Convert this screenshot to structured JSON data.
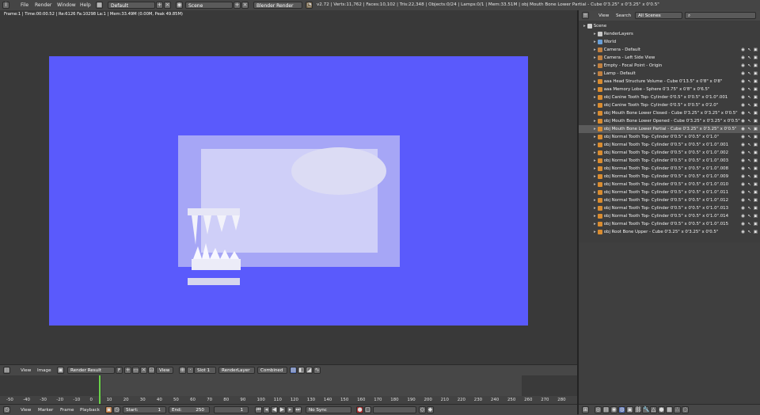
{
  "top": {
    "menus": [
      "File",
      "Render",
      "Window",
      "Help"
    ],
    "layout": "Default",
    "scene": "Scene",
    "engine": "Blender Render",
    "stats": "v2.72 | Verts:11,762 | Faces:10,102 | Tris:22,348 | Objects:0/24 | Lamps:0/1 | Mem:33.51M | obj Mouth Bone Lower Partial - Cube 0'3.25\" x 0'3.25\" x 0'0.5\""
  },
  "viewport": {
    "render_info": "Frame:1 | Time:00:00.52 | Re:6126 Fa:10298 La:1 | Mem:33.49M (0.00M, Peak 49.85M)"
  },
  "image_editor": {
    "view": "View",
    "image": "Image",
    "image_name": "Render Result",
    "f_label": "F",
    "view_dropdown": "View",
    "slot": "Slot 1",
    "layer": "RenderLayer",
    "pass": "Combined"
  },
  "timeline": {
    "ticks": [
      "-50",
      "-40",
      "-30",
      "-20",
      "-10",
      "0",
      "10",
      "20",
      "30",
      "40",
      "50",
      "60",
      "70",
      "80",
      "90",
      "100",
      "110",
      "120",
      "130",
      "140",
      "150",
      "160",
      "170",
      "180",
      "190",
      "200",
      "210",
      "220",
      "230",
      "240",
      "250",
      "260",
      "270",
      "280"
    ],
    "current_frame": 1,
    "menu": [
      "View",
      "Marker",
      "Frame",
      "Playback"
    ],
    "start": "Start:",
    "start_val": "1",
    "end": "End:",
    "end_val": "250",
    "frame": "1",
    "sync": "No Sync"
  },
  "outliner": {
    "view": "View",
    "search": "Search",
    "scenes": "All Scenes",
    "rows": [
      {
        "label": "Scene",
        "indent": 0,
        "color": "#d0d0d0"
      },
      {
        "label": "RenderLayers",
        "indent": 1,
        "color": "#c8c8c8"
      },
      {
        "label": "World",
        "indent": 1,
        "color": "#6aa0d8"
      },
      {
        "label": "Camera - Default",
        "indent": 1,
        "color": "#c08040"
      },
      {
        "label": "Camera - Left Side View",
        "indent": 1,
        "color": "#c08040"
      },
      {
        "label": "Empty - Focal Point - Origin",
        "indent": 1,
        "color": "#c08040"
      },
      {
        "label": "Lamp - Default",
        "indent": 1,
        "color": "#c08040"
      },
      {
        "label": "aaa Head Structure Volume - Cube 0'13.5\" x 0'8\" x 0'8\"",
        "indent": 1,
        "color": "#d98c30"
      },
      {
        "label": "aaa Memory Lobe - Sphere 0'3.75\" x 0'8\" x 0'6.5\"",
        "indent": 1,
        "color": "#d98c30"
      },
      {
        "label": "obj Canine Tooth Top- Cylinder 0'0.5\" x 0'0.5\" x 0'1.0\".001",
        "indent": 1,
        "color": "#d98c30"
      },
      {
        "label": "obj Canine Tooth Top- Cylinder 0'0.5\" x 0'0.5\" x 0'2.0\"",
        "indent": 1,
        "color": "#d98c30"
      },
      {
        "label": "obj Mouth Bone Lower Closed - Cube 0'3.25\" x 0'3.25\" x 0'0.5\"",
        "indent": 1,
        "color": "#d98c30"
      },
      {
        "label": "obj Mouth Bone Lower Opened - Cube 0'3.25\" x 0'3.25\" x 0'0.5\"",
        "indent": 1,
        "color": "#d98c30"
      },
      {
        "label": "obj Mouth Bone Lower Partial - Cube 0'3.25\" x 0'3.25\" x 0'0.5\"",
        "indent": 1,
        "color": "#d98c30",
        "selected": true
      },
      {
        "label": "obj Normal Tooth Top- Cylinder 0'0.5\" x 0'0.5\" x 0'1.0\"",
        "indent": 1,
        "color": "#d98c30"
      },
      {
        "label": "obj Normal Tooth Top- Cylinder 0'0.5\" x 0'0.5\" x 0'1.0\".001",
        "indent": 1,
        "color": "#d98c30"
      },
      {
        "label": "obj Normal Tooth Top- Cylinder 0'0.5\" x 0'0.5\" x 0'1.0\".002",
        "indent": 1,
        "color": "#d98c30"
      },
      {
        "label": "obj Normal Tooth Top- Cylinder 0'0.5\" x 0'0.5\" x 0'1.0\".003",
        "indent": 1,
        "color": "#d98c30"
      },
      {
        "label": "obj Normal Tooth Top- Cylinder 0'0.5\" x 0'0.5\" x 0'1.0\".008",
        "indent": 1,
        "color": "#d98c30"
      },
      {
        "label": "obj Normal Tooth Top- Cylinder 0'0.5\" x 0'0.5\" x 0'1.0\".009",
        "indent": 1,
        "color": "#d98c30"
      },
      {
        "label": "obj Normal Tooth Top- Cylinder 0'0.5\" x 0'0.5\" x 0'1.0\".010",
        "indent": 1,
        "color": "#d98c30"
      },
      {
        "label": "obj Normal Tooth Top- Cylinder 0'0.5\" x 0'0.5\" x 0'1.0\".011",
        "indent": 1,
        "color": "#d98c30"
      },
      {
        "label": "obj Normal Tooth Top- Cylinder 0'0.5\" x 0'0.5\" x 0'1.0\".012",
        "indent": 1,
        "color": "#d98c30"
      },
      {
        "label": "obj Normal Tooth Top- Cylinder 0'0.5\" x 0'0.5\" x 0'1.0\".013",
        "indent": 1,
        "color": "#d98c30"
      },
      {
        "label": "obj Normal Tooth Top- Cylinder 0'0.5\" x 0'0.5\" x 0'1.0\".014",
        "indent": 1,
        "color": "#d98c30"
      },
      {
        "label": "obj Normal Tooth Top- Cylinder 0'0.5\" x 0'0.5\" x 0'1.0\".015",
        "indent": 1,
        "color": "#d98c30"
      },
      {
        "label": "obj Root Bone Upper - Cube 0'3.25\" x 0'3.25\" x 0'0.5\"",
        "indent": 1,
        "color": "#d98c30"
      }
    ]
  },
  "colors": {
    "render_bg": "#5a5afc",
    "selected_row": "#5b5b5b",
    "frame_line": "#6ad24a"
  }
}
